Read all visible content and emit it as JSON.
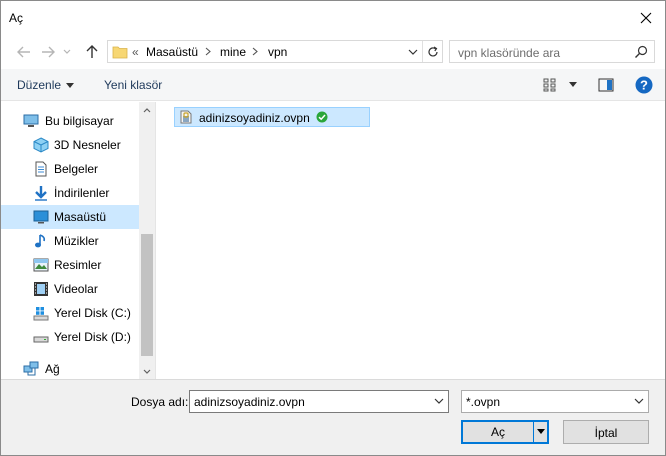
{
  "window": {
    "title": "Aç"
  },
  "address": {
    "overflow": "«",
    "crumbs": [
      "Masaüstü",
      "mine",
      "vpn"
    ],
    "search_placeholder": "vpn klasöründe ara"
  },
  "toolbar": {
    "organize_label": "Düzenle",
    "new_folder_label": "Yeni klasör"
  },
  "nav_tree": {
    "items": [
      {
        "label": "Bu bilgisayar",
        "icon": "computer-icon"
      },
      {
        "label": "3D Nesneler",
        "icon": "3d-objects-icon"
      },
      {
        "label": "Belgeler",
        "icon": "documents-icon"
      },
      {
        "label": "İndirilenler",
        "icon": "downloads-icon"
      },
      {
        "label": "Masaüstü",
        "icon": "desktop-icon",
        "selected": true
      },
      {
        "label": "Müzikler",
        "icon": "music-icon"
      },
      {
        "label": "Resimler",
        "icon": "pictures-icon"
      },
      {
        "label": "Videolar",
        "icon": "videos-icon"
      },
      {
        "label": "Yerel Disk (C:)",
        "icon": "windows-drive-icon"
      },
      {
        "label": "Yerel Disk (D:)",
        "icon": "drive-icon"
      },
      {
        "label": "Ağ",
        "icon": "network-icon"
      }
    ]
  },
  "files": [
    {
      "name": "adinizsoyadiniz.ovpn",
      "status": "synced",
      "selected": true
    }
  ],
  "bottom": {
    "filename_label": "Dosya adı:",
    "filename_value": "adinizsoyadiniz.ovpn",
    "filetype_value": "*.ovpn",
    "open_label": "Aç",
    "cancel_label": "İptal"
  },
  "colors": {
    "selection": "#cce8ff",
    "accent": "#0078d7",
    "sync_green": "#2aa63a"
  }
}
